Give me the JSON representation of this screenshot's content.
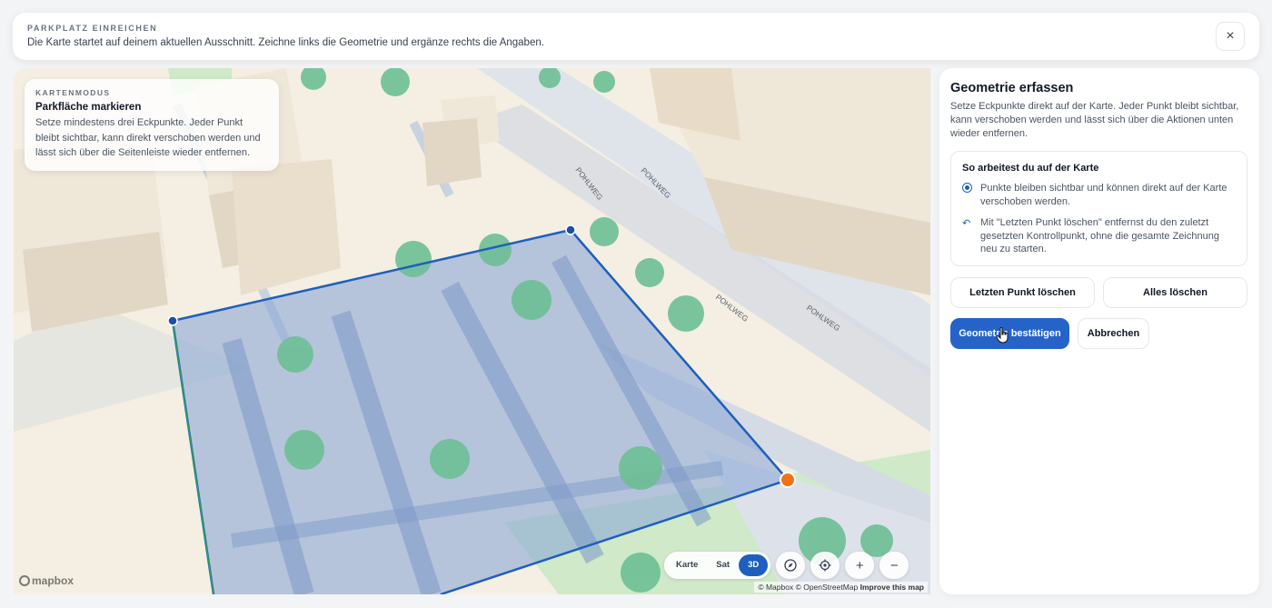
{
  "header": {
    "eyebrow": "PARKPLATZ EINREICHEN",
    "subtitle": "Die Karte startet auf deinem aktuellen Ausschnitt. Zeichne links die Geometrie und ergänze rechts die Angaben.",
    "close_symbol": "×"
  },
  "map": {
    "mode_card": {
      "eyebrow": "KARTENMODUS",
      "title": "Parkfläche markieren",
      "description": "Setze mindestens drei Eckpunkte. Jeder Punkt bleibt sichtbar, kann direkt verschoben werden und lässt sich über die Seitenleiste wieder entfernen."
    },
    "street_labels": [
      "POHLWEG",
      "POHLWEG",
      "POHLWEG",
      "POHLWEG"
    ],
    "view_modes": [
      "Karte",
      "Sat",
      "3D"
    ],
    "active_view_mode": "3D",
    "controls": {
      "zoom_in": "+",
      "zoom_out": "−"
    },
    "logo": "mapbox",
    "attribution": {
      "mapbox": "© Mapbox",
      "osm": "© OpenStreetMap",
      "improve": "Improve this map"
    },
    "colors": {
      "polygon_fill": "#8ea9d6",
      "polygon_stroke": "#1e5fbf",
      "vertex": "#1d4fa8",
      "active_vertex": "#f07316"
    }
  },
  "panel": {
    "title": "Geometrie erfassen",
    "description": "Setze Eckpunkte direkt auf der Karte. Jeder Punkt bleibt sichtbar, kann verschoben werden und lässt sich über die Aktionen unten wieder entfernen.",
    "howto": {
      "title": "So arbeitest du auf der Karte",
      "items": [
        {
          "icon": "radio-icon",
          "text": "Punkte bleiben sichtbar und können direkt auf der Karte verschoben werden."
        },
        {
          "icon": "undo-icon",
          "text": "Mit \"Letzten Punkt löschen\" entfernst du den zuletzt gesetzten Kontrollpunkt, ohne die gesamte Zeichnung neu zu starten."
        }
      ]
    },
    "buttons": {
      "undo_last": "Letzten Punkt löschen",
      "clear_all": "Alles löschen",
      "confirm": "Geometrie bestätigen",
      "cancel": "Abbrechen"
    },
    "accent": "#2563c9"
  }
}
